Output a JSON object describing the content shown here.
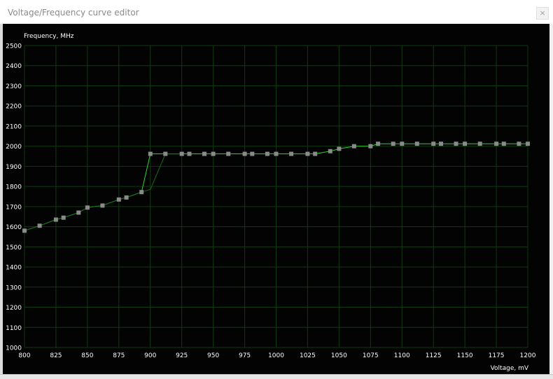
{
  "window": {
    "title": "Voltage/Frequency curve editor",
    "close_glyph": "×"
  },
  "colors": {
    "background": "#030303",
    "grid": "#0f3a0f",
    "curve": "#2bd62b",
    "curve_dim": "#1b6a1b",
    "marker": "#8a8a8a",
    "text": "#ffffff"
  },
  "chart_data": {
    "type": "line",
    "title": "",
    "ylabel": "Frequency, MHz",
    "xlabel": "Voltage, mV",
    "xlim": [
      800,
      1200
    ],
    "ylim": [
      1000,
      2500
    ],
    "grid": true,
    "x_ticks": [
      "800",
      "825",
      "850",
      "875",
      "900",
      "925",
      "950",
      "975",
      "1000",
      "1025",
      "1050",
      "1075",
      "1100",
      "1125",
      "1150",
      "1175",
      "1200"
    ],
    "y_ticks": [
      "1000",
      "1100",
      "1200",
      "1300",
      "1400",
      "1500",
      "1600",
      "1700",
      "1800",
      "1900",
      "2000",
      "2100",
      "2200",
      "2300",
      "2400",
      "2500"
    ],
    "series": [
      {
        "role": "active",
        "x": [
          800,
          812,
          825,
          831,
          843,
          850,
          862,
          875,
          881,
          893,
          900,
          912,
          925,
          931,
          943,
          950,
          962,
          975,
          981,
          993,
          1000,
          1012,
          1025,
          1031,
          1043,
          1050,
          1062,
          1075,
          1081,
          1093,
          1100,
          1112,
          1125,
          1131,
          1143,
          1150,
          1162,
          1175,
          1181,
          1193,
          1200
        ],
        "y": [
          1580,
          1605,
          1635,
          1645,
          1670,
          1695,
          1705,
          1735,
          1745,
          1772,
          1962,
          1962,
          1962,
          1962,
          1962,
          1962,
          1962,
          1962,
          1962,
          1962,
          1962,
          1962,
          1962,
          1962,
          1975,
          1987,
          2000,
          2000,
          2012,
          2012,
          2012,
          2012,
          2012,
          2012,
          2012,
          2012,
          2012,
          2012,
          2012,
          2012,
          2012
        ]
      },
      {
        "role": "reference",
        "x": [
          800,
          812,
          825,
          831,
          843,
          850,
          862,
          875,
          881,
          893,
          900,
          912,
          925
        ],
        "y": [
          1580,
          1605,
          1635,
          1645,
          1670,
          1695,
          1705,
          1735,
          1745,
          1772,
          1785,
          1962,
          1962
        ]
      }
    ]
  }
}
